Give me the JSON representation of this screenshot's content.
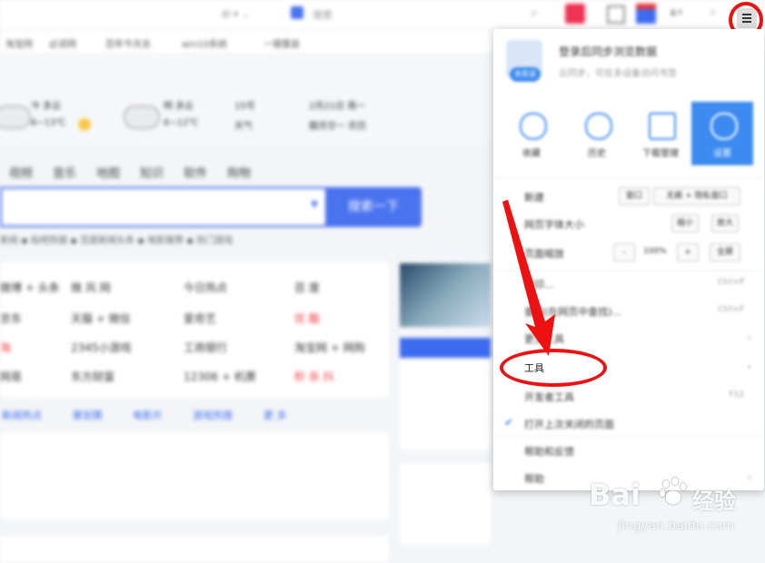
{
  "browser": {
    "address_fragment": "搜索",
    "icons": [
      "search-icon",
      "app-icon",
      "grid-icon",
      "badge-icon",
      "user-icon",
      "download-icon",
      "menu-icon"
    ]
  },
  "bookmarks": [
    "淘宝网",
    "必读网",
    "百年今天去",
    "win10系统",
    "一键重装"
  ],
  "weather": [
    {
      "city": "今 多云",
      "temp": "6~13℃"
    },
    {
      "city": "明 多云",
      "temp": "6~12℃"
    },
    {
      "city": "15号",
      "temp": "天气"
    },
    {
      "city": "2月21日 周一",
      "temp": "腊月廿一 农历"
    }
  ],
  "nav": [
    "视频",
    "音乐",
    "地图",
    "知识",
    "软件",
    "购物"
  ],
  "search": {
    "button": "搜索一下",
    "placeholder": ""
  },
  "hot_links": "新闻 ◆ 贴吧热搜 ◆ 百度新闻头条 ◆ 电影推荐 ◆ 热门游戏",
  "sites": [
    [
      "微博 + 头条",
      "微 风 网",
      "今日热点",
      "百 度"
    ],
    [
      "京东",
      "天猫 + 微信",
      "爱奇艺",
      "优 酷"
    ],
    [
      "淘",
      "2345小游戏",
      "工商银行",
      "淘宝网 + 网购"
    ],
    [
      "网易",
      "东方财富",
      "12306 + 机票",
      "秒 杀 抖"
    ]
  ],
  "tabs": [
    "新闻热点",
    "聚划算",
    "电影片",
    "游戏热搜",
    "更 多"
  ],
  "menu": {
    "login": {
      "title": "登录后同步浏览数据",
      "subtitle": "云同步，可在多设备访问书签",
      "avatar_badge": "未登录"
    },
    "tiles": [
      {
        "label": "收藏",
        "icon": "star-icon"
      },
      {
        "label": "历史",
        "icon": "clock-icon"
      },
      {
        "label": "下载管理",
        "icon": "download-box-icon"
      },
      {
        "label": "设置",
        "icon": "gear-icon",
        "active": true
      }
    ],
    "rows": [
      {
        "label": "新建",
        "buttons": [
          "窗口",
          "无痕 + 隐私窗口"
        ]
      },
      {
        "label": "网页字体大小",
        "buttons": [
          "缩小",
          "放大"
        ]
      },
      {
        "label": "页面缩放",
        "zoom": "100%",
        "buttons": [
          "-",
          "+",
          "全屏"
        ]
      },
      {
        "label": "打印...",
        "kbd": "Ctrl+P"
      },
      {
        "label": "查找(在网页中查找)...",
        "kbd": "Ctrl+F"
      },
      {
        "label": "更多工具",
        "arrow": "›"
      },
      {
        "label": "工具",
        "arrow": "›"
      },
      {
        "label": "开发者工具",
        "kbd": "F12"
      },
      {
        "label": "打开上次关闭的页面",
        "check": "✔"
      },
      {
        "label": "帮助和反馈"
      },
      {
        "label": "帮助",
        "arrow": "›"
      }
    ]
  },
  "watermark": {
    "brand": "Bai",
    "brand_cn": "经验",
    "url": "jingyan.baidu.com"
  },
  "colors": {
    "accent": "#3d8bf0",
    "annotation": "#ee1111",
    "search_blue": "#4a73f0"
  }
}
